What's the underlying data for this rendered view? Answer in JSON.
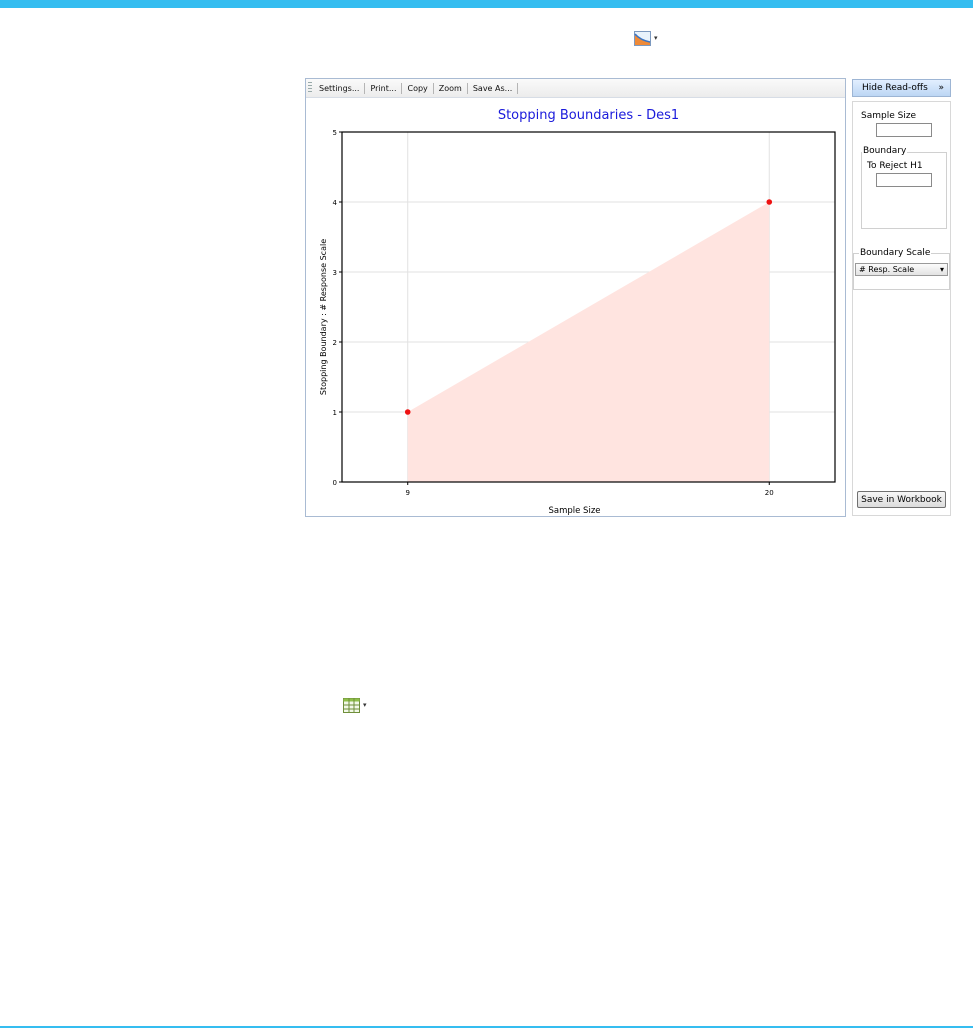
{
  "colors": {
    "accent": "#35bdf0",
    "title": "#1a1adb",
    "fill": "#ffe4e0",
    "point": "#ee1111"
  },
  "icons": {
    "chart_menu": "chart-icon",
    "table_menu": "table-icon",
    "expand": "double-chevron-right-icon",
    "dropdown": "caret-down-icon"
  },
  "toolbar": {
    "items": [
      "Settings...",
      "Print...",
      "Copy",
      "Zoom",
      "Save As..."
    ]
  },
  "chart_data": {
    "type": "area",
    "title": "Stopping Boundaries - Des1",
    "xlabel": "Sample Size",
    "ylabel": "Stopping Boundary : # Response Scale",
    "x": [
      9,
      20
    ],
    "series": [
      {
        "values": [
          1,
          4
        ]
      }
    ],
    "x_ticks": [
      "9",
      "20"
    ],
    "y_ticks": [
      "0",
      "1",
      "2",
      "3",
      "4",
      "5"
    ],
    "ylim": [
      0,
      5
    ],
    "grid": true
  },
  "readoffs": {
    "hide_label": "Hide Read-offs",
    "expand_glyph": "»",
    "sample_size_label": "Sample Size",
    "boundary_group_label": "Boundary",
    "reject_label": "To Reject H1",
    "scale_label": "Boundary Scale",
    "scale_value": "# Resp. Scale",
    "dropdown_glyph": "▾",
    "save_label": "Save in Workbook"
  }
}
